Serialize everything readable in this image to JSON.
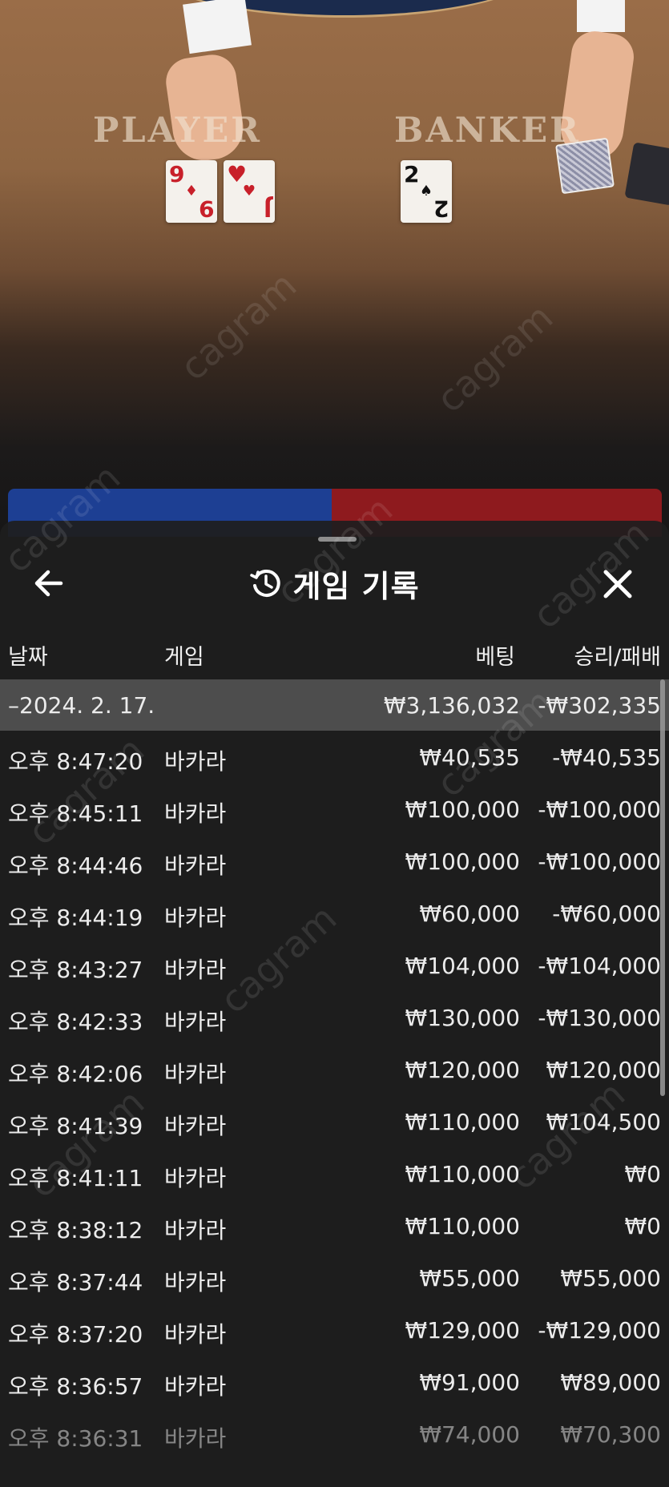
{
  "scene": {
    "player_label": "PLAYER",
    "banker_label": "BANKER",
    "player_cards": [
      {
        "rank": "9",
        "suit": "♦"
      },
      {
        "rank": "J",
        "suit": "♥"
      }
    ],
    "banker_cards": [
      {
        "rank": "2",
        "suit": "♠"
      }
    ]
  },
  "header": {
    "title": "게임 기록",
    "back_icon": "arrow-left-icon",
    "history_icon": "history-clock-icon",
    "close_icon": "close-icon"
  },
  "columns": {
    "date": "날짜",
    "game": "게임",
    "bet": "베팅",
    "result": "승리/패배"
  },
  "group": {
    "date": "–2024. 2. 17.",
    "bet": "₩3,136,032",
    "result": "-₩302,335"
  },
  "rows": [
    {
      "time": "오후 8:47:20",
      "game": "바카라",
      "bet": "₩40,535",
      "result": "-₩40,535"
    },
    {
      "time": "오후 8:45:11",
      "game": "바카라",
      "bet": "₩100,000",
      "result": "-₩100,000"
    },
    {
      "time": "오후 8:44:46",
      "game": "바카라",
      "bet": "₩100,000",
      "result": "-₩100,000"
    },
    {
      "time": "오후 8:44:19",
      "game": "바카라",
      "bet": "₩60,000",
      "result": "-₩60,000"
    },
    {
      "time": "오후 8:43:27",
      "game": "바카라",
      "bet": "₩104,000",
      "result": "-₩104,000"
    },
    {
      "time": "오후 8:42:33",
      "game": "바카라",
      "bet": "₩130,000",
      "result": "-₩130,000"
    },
    {
      "time": "오후 8:42:06",
      "game": "바카라",
      "bet": "₩120,000",
      "result": "₩120,000"
    },
    {
      "time": "오후 8:41:39",
      "game": "바카라",
      "bet": "₩110,000",
      "result": "₩104,500"
    },
    {
      "time": "오후 8:41:11",
      "game": "바카라",
      "bet": "₩110,000",
      "result": "₩0"
    },
    {
      "time": "오후 8:38:12",
      "game": "바카라",
      "bet": "₩110,000",
      "result": "₩0"
    },
    {
      "time": "오후 8:37:44",
      "game": "바카라",
      "bet": "₩55,000",
      "result": "₩55,000"
    },
    {
      "time": "오후 8:37:20",
      "game": "바카라",
      "bet": "₩129,000",
      "result": "-₩129,000"
    },
    {
      "time": "오후 8:36:57",
      "game": "바카라",
      "bet": "₩91,000",
      "result": "₩89,000"
    },
    {
      "time": "오후 8:36:31",
      "game": "바카라",
      "bet": "₩74,000",
      "result": "₩70,300"
    }
  ],
  "watermark": "cagram",
  "colors": {
    "sheet_bg": "#1e1e1e",
    "group_row_bg": "#4d4d4d",
    "player_blue": "#1d3f93",
    "banker_red": "#8e1a1e"
  }
}
